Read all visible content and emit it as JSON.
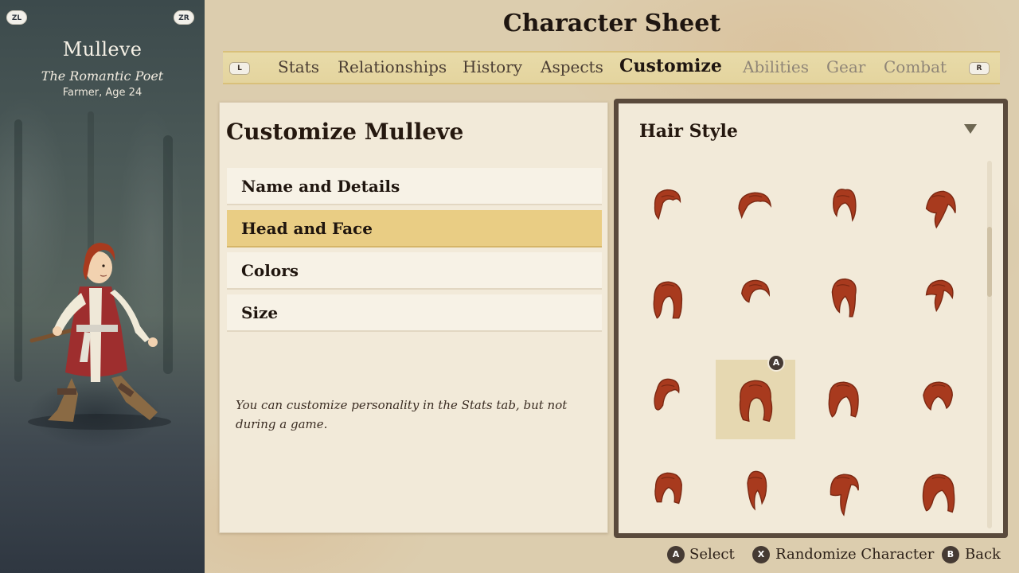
{
  "controls": {
    "zl": "ZL",
    "zr": "ZR",
    "l": "L",
    "r": "R"
  },
  "character": {
    "name": "Mulleve",
    "title": "The Romantic Poet",
    "subtitle": "Farmer, Age 24"
  },
  "page_title": "Character Sheet",
  "tabs": [
    {
      "label": "Stats",
      "state": "normal"
    },
    {
      "label": "Relationships",
      "state": "normal"
    },
    {
      "label": "History",
      "state": "normal"
    },
    {
      "label": "Aspects",
      "state": "normal"
    },
    {
      "label": "Customize",
      "state": "active"
    },
    {
      "label": "Abilities",
      "state": "disabled"
    },
    {
      "label": "Gear",
      "state": "disabled"
    },
    {
      "label": "Combat",
      "state": "disabled"
    }
  ],
  "customize": {
    "title": "Customize Mulleve",
    "items": [
      {
        "label": "Name and Details"
      },
      {
        "label": "Head and Face"
      },
      {
        "label": "Colors"
      },
      {
        "label": "Size"
      }
    ],
    "selected_item": "Head and Face",
    "hint": "You can customize personality in the Stats tab, but not during a game."
  },
  "hair_panel": {
    "header": "Hair Style",
    "dropdown_icon": "triangle-down-icon",
    "selected_index": 9,
    "selected_marker": "A",
    "hair_color": "#a83a1e"
  },
  "footer": {
    "select_button": "A",
    "select_label": "Select",
    "randomize_button": "X",
    "randomize_label": "Randomize Character",
    "back_button": "B",
    "back_label": "Back"
  },
  "colors": {
    "parchment": "#dccdae",
    "panel": "#f2ead9",
    "highlight": "#e9cd84",
    "tab_bar": "#e6d8a3",
    "frame": "#5a4a3c"
  }
}
